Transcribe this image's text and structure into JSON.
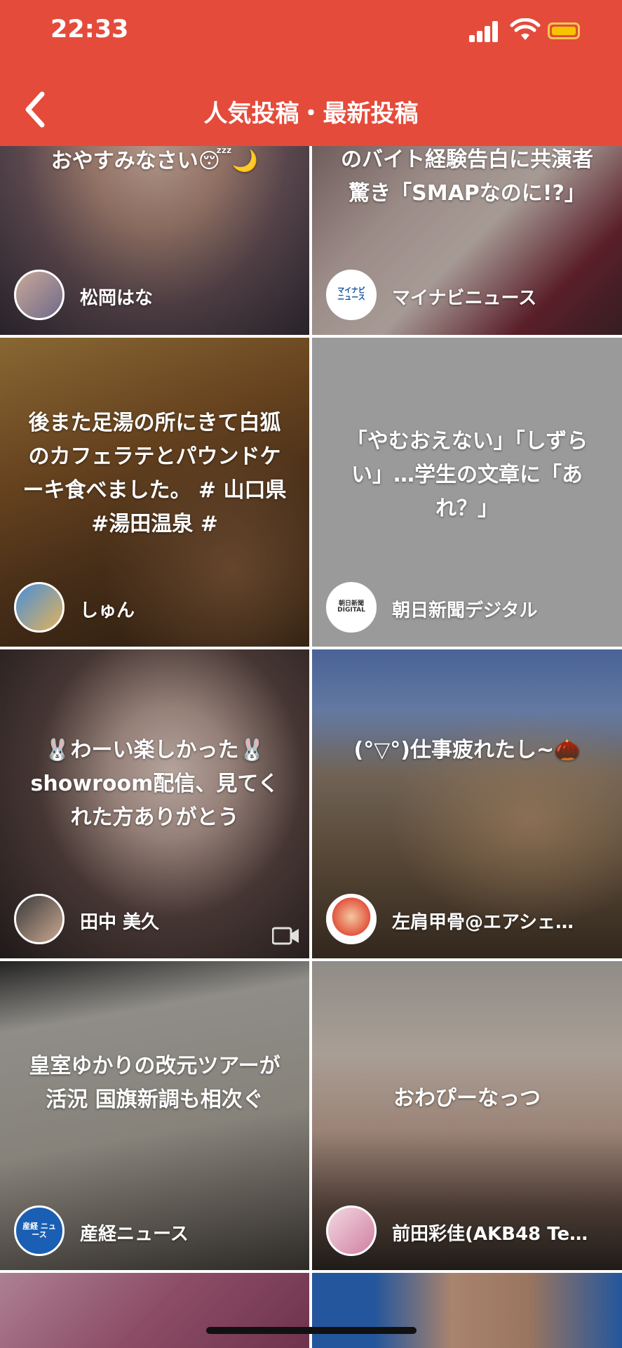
{
  "status_bar": {
    "time": "22:33"
  },
  "header": {
    "title": "人気投稿・最新投稿"
  },
  "icons": {
    "back": "chevron-left-icon",
    "signal": "signal-icon",
    "wifi": "wifi-icon",
    "battery": "battery-icon",
    "video": "video-camera-icon"
  },
  "colors": {
    "header_bg": "#e44b3b",
    "battery": "#f7c400"
  },
  "posts": [
    {
      "caption": "おやすみなさい😴🌙",
      "author": "松岡はな"
    },
    {
      "caption": "のバイト経験告白に共演者驚き「SMAPなのに!?」",
      "author": "マイナビニュース",
      "avatar_text": "マイナビ ニュース"
    },
    {
      "caption": "後また足湯の所にきて白狐のカフェラテとパウンドケーキ食べました。 # 山口県 #湯田温泉 #",
      "author": "しゅん"
    },
    {
      "caption": "「やむおえない」「しずらい」…学生の文章に「あれ？」",
      "author": "朝日新聞デジタル",
      "avatar_text": "朝日新聞 DIGITAL"
    },
    {
      "caption": "🐰わーい楽しかった🐰 showroom配信、見てくれた方ありがとう",
      "author": "田中 美久"
    },
    {
      "caption": "(°▽°)仕事疲れたし~🌰",
      "author": "左肩甲骨@エアシェ…"
    },
    {
      "caption": "皇室ゆかりの改元ツアーが活況 国旗新調も相次ぐ",
      "author": "産経ニュース",
      "avatar_text": "産経 ニュース"
    },
    {
      "caption": "おわぴーなっつ",
      "author": "前田彩佳(AKB48 Te…"
    }
  ]
}
